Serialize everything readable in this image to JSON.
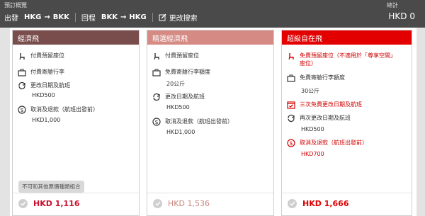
{
  "header": {
    "overview_label": "預訂概覽",
    "total_label": "總計",
    "outbound_label": "出發",
    "outbound_from": "HKG",
    "outbound_to": "BKK",
    "return_label": "回程",
    "return_from": "BKK",
    "return_to": "HKG",
    "edit_search_label": "更改搜索",
    "total_value": "HKD 0",
    "arrow_icon": "arrow-right-icon",
    "edit_icon": "edit-icon"
  },
  "fares": [
    {
      "name": "經濟飛",
      "header_color": "#7a4d4d",
      "features": [
        {
          "icon": "seat-icon",
          "label": "付費預留座位"
        },
        {
          "icon": "baggage-icon",
          "label": "付費寄艙行李"
        },
        {
          "icon": "change-icon",
          "label": "更改日期及航班",
          "value": "HKD500"
        },
        {
          "icon": "refund-icon",
          "label": "取消及退款（航班出發前）",
          "value": "HKD1,000"
        }
      ],
      "note": "不可和其他票價種類組合",
      "price": "HKD 1,116"
    },
    {
      "name": "精選經濟飛",
      "header_color": "#d58a84",
      "features": [
        {
          "icon": "seat-icon",
          "label": "付費預留座位"
        },
        {
          "icon": "baggage-icon",
          "label": "免費寄艙行李額度",
          "value": "20公斤"
        },
        {
          "icon": "change-icon",
          "label": "更改日期及航班",
          "value": "HKD500"
        },
        {
          "icon": "refund-icon",
          "label": "取消及退款（航班出發前）",
          "value": "HKD1,000"
        }
      ],
      "price": "HKD 1,536"
    },
    {
      "name": "超級自在飛",
      "header_color": "#e30000",
      "features": [
        {
          "icon": "seat-icon",
          "label": "免費預留座位（不適用於「尊享空間」",
          "label2": "座位）"
        },
        {
          "icon": "baggage-icon",
          "label": "免費寄艙行李額度",
          "value": "30公斤"
        },
        {
          "icon": "calendar-check-icon",
          "label": "三次免費更改日期及航班"
        },
        {
          "icon": "change-icon",
          "label": "再次更改日期及航班",
          "value": "HKD500"
        },
        {
          "icon": "refund-icon",
          "label": "取消及退款（航班出發前）",
          "value": "HKD700"
        }
      ],
      "price": "HKD 1,666"
    }
  ]
}
